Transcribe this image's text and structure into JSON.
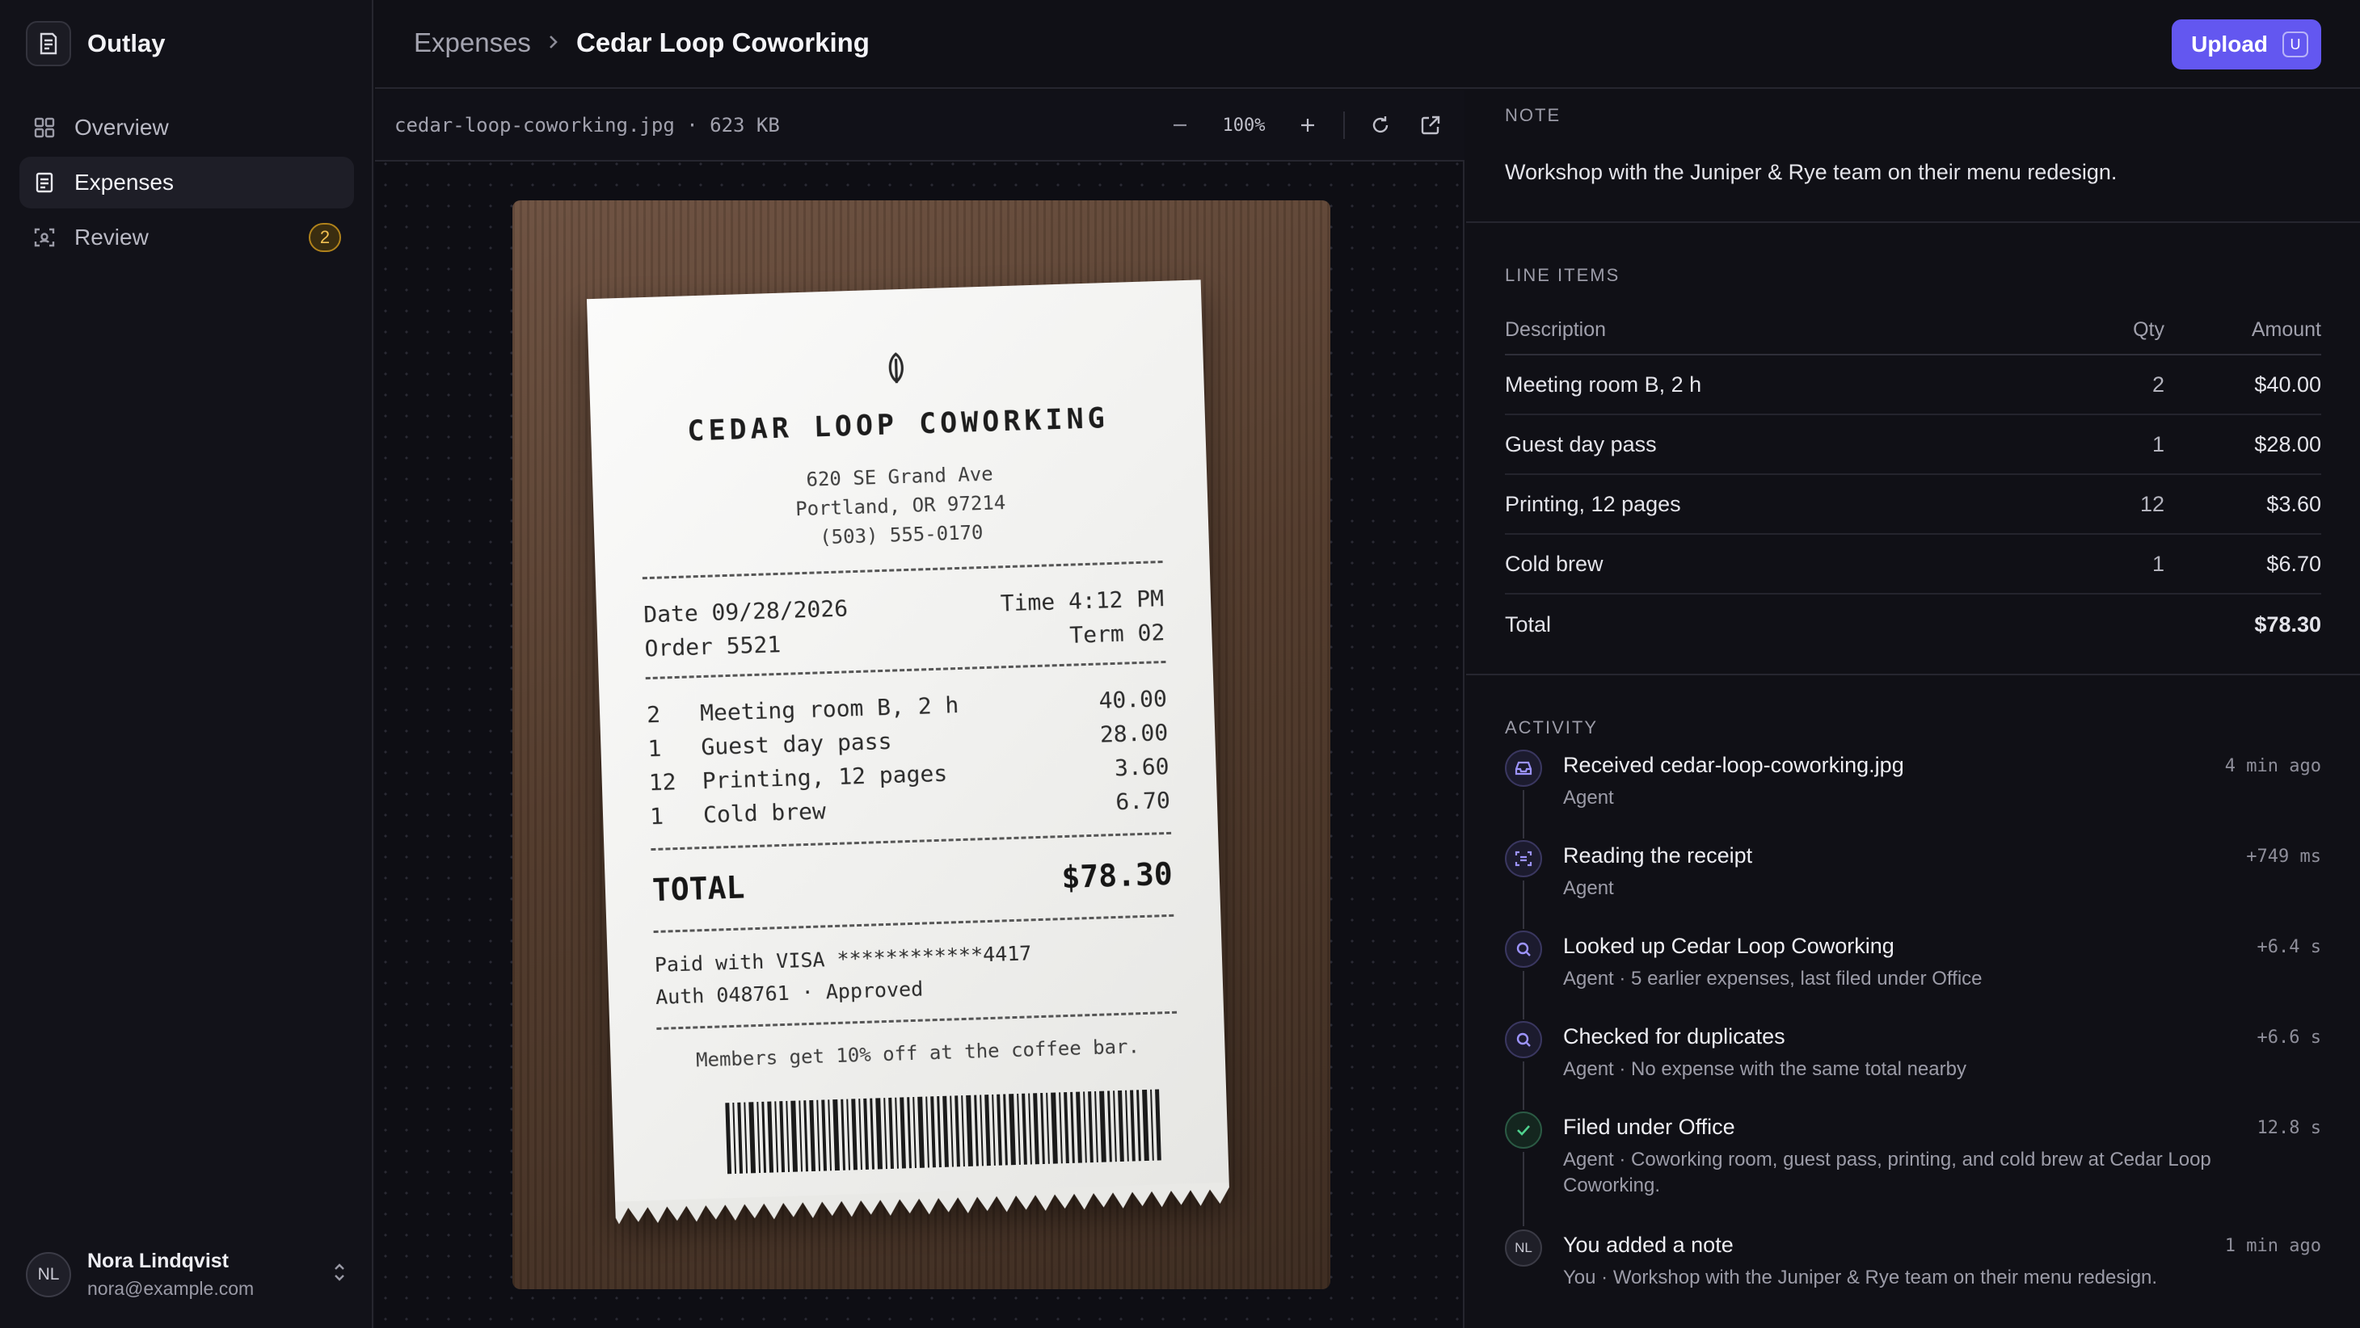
{
  "app": {
    "name": "Outlay"
  },
  "sidebar": {
    "items": [
      {
        "label": "Overview",
        "icon": "grid-icon"
      },
      {
        "label": "Expenses",
        "icon": "receipt-icon",
        "active": true
      },
      {
        "label": "Review",
        "icon": "scan-icon",
        "badge": "2"
      }
    ],
    "user": {
      "initials": "NL",
      "name": "Nora Lindqvist",
      "email": "nora@example.com"
    }
  },
  "header": {
    "breadcrumb_parent": "Expenses",
    "breadcrumb_current": "Cedar Loop Coworking",
    "upload_label": "Upload",
    "upload_shortcut": "U",
    "accent": "#6357f0"
  },
  "viewer": {
    "file_info": "cedar-loop-coworking.jpg · 623 KB",
    "zoom": "100%",
    "receipt": {
      "title": "CEDAR LOOP COWORKING",
      "address1": "620 SE Grand Ave",
      "address2": "Portland, OR 97214",
      "phone": "(503) 555-0170",
      "date": "Date 09/28/2026",
      "time": "Time 4:12 PM",
      "order": "Order 5521",
      "term": "Term 02",
      "lines": [
        {
          "qty": "2",
          "desc": "Meeting room B, 2 h",
          "amount": "40.00"
        },
        {
          "qty": "1",
          "desc": "Guest day pass",
          "amount": "28.00"
        },
        {
          "qty": "12",
          "desc": "Printing, 12 pages",
          "amount": "3.60"
        },
        {
          "qty": "1",
          "desc": "Cold brew",
          "amount": "6.70"
        }
      ],
      "total_label": "TOTAL",
      "total": "$78.30",
      "paid": "Paid with VISA ************4417",
      "auth": "Auth 048761 · Approved",
      "footer": "Members get 10% off at the coffee bar."
    }
  },
  "note": {
    "label": "NOTE",
    "text": "Workshop with the Juniper & Rye team on their menu redesign."
  },
  "line_items": {
    "label": "LINE ITEMS",
    "headers": {
      "description": "Description",
      "qty": "Qty",
      "amount": "Amount"
    },
    "rows": [
      {
        "description": "Meeting room B, 2 h",
        "qty": "2",
        "amount": "$40.00"
      },
      {
        "description": "Guest day pass",
        "qty": "1",
        "amount": "$28.00"
      },
      {
        "description": "Printing, 12 pages",
        "qty": "12",
        "amount": "$3.60"
      },
      {
        "description": "Cold brew",
        "qty": "1",
        "amount": "$6.70"
      }
    ],
    "total_label": "Total",
    "total": "$78.30"
  },
  "activity": {
    "label": "ACTIVITY",
    "events": [
      {
        "icon": "inbox-icon",
        "title": "Received cedar-loop-coworking.jpg",
        "meta": "Agent",
        "time": "4 min ago"
      },
      {
        "icon": "scan-text-icon",
        "title": "Reading the receipt",
        "meta": "Agent",
        "time": "+749 ms"
      },
      {
        "icon": "search-icon",
        "title": "Looked up Cedar Loop Coworking",
        "meta": "Agent · 5 earlier expenses, last filed under Office",
        "time": "+6.4 s"
      },
      {
        "icon": "search-icon",
        "title": "Checked for duplicates",
        "meta": "Agent · No expense with the same total nearby",
        "time": "+6.6 s"
      },
      {
        "icon": "check-icon",
        "title": "Filed under Office",
        "meta": "Agent · Coworking room, guest pass, printing, and cold brew at Cedar Loop Coworking.",
        "time": "12.8 s"
      },
      {
        "icon": "user-avatar",
        "initials": "NL",
        "title": "You added a note",
        "meta": "You · Workshop with the Juniper & Rye team on their menu redesign.",
        "time": "1 min ago"
      }
    ]
  }
}
